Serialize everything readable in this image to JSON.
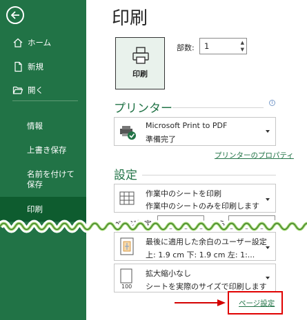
{
  "sidebar": {
    "items": [
      {
        "label": "ホーム",
        "icon": "home-icon"
      },
      {
        "label": "新規",
        "icon": "new-document-icon"
      },
      {
        "label": "開く",
        "icon": "folder-open-icon"
      },
      {
        "label": "情報"
      },
      {
        "label": "上書き保存"
      },
      {
        "label": "名前を付けて保存"
      },
      {
        "label": "印刷"
      }
    ],
    "colors": {
      "background": "#217346",
      "active": "#0e5c2f"
    }
  },
  "main": {
    "title": "印刷",
    "print_button_label": "印刷",
    "copies_label": "部数:",
    "copies_value": "1",
    "printer_section": "プリンター",
    "printer_name": "Microsoft Print to PDF",
    "printer_status": "準備完了",
    "printer_properties_link": "プリンターのプロパティ",
    "settings_section": "設定",
    "settings": [
      {
        "line1": "作業中のシートを印刷",
        "line2": "作業中のシートのみを印刷します",
        "icon": "sheet-grid-icon"
      },
      {
        "line1": "最後に適用した余白のユーザー設定",
        "line2": "上: 1.9 cm 下: 1.9 cm 左: 1:...",
        "icon": "margins-icon"
      },
      {
        "line1": "拡大縮小なし",
        "line2": "シートを実際のサイズで印刷します",
        "icon": "scale-100-icon"
      }
    ],
    "pages_label": "ページ指定:",
    "pages_to_label": "から",
    "page_setup_link": "ページ設定",
    "info_icon": "i"
  }
}
